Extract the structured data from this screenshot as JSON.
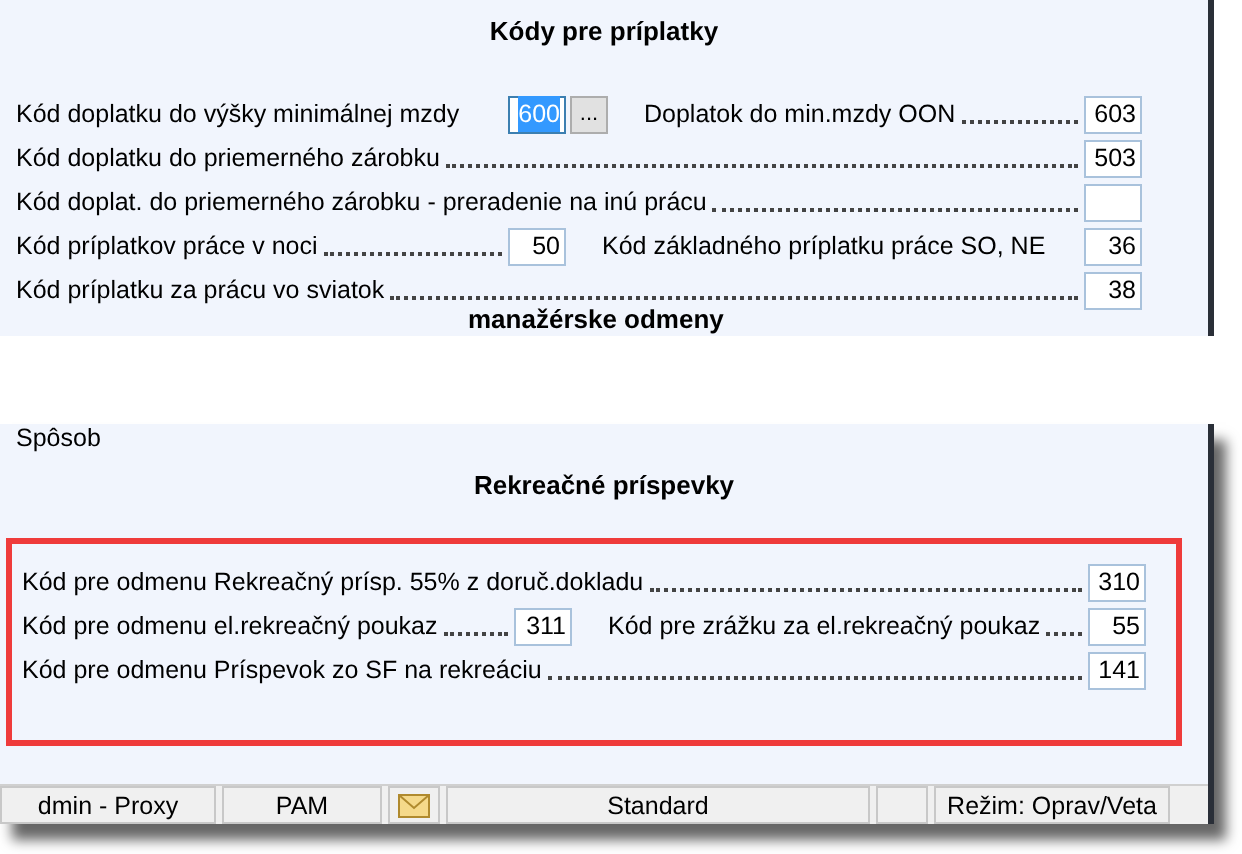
{
  "section_1": {
    "title": "Kódy pre príplatky",
    "rows": [
      {
        "items": [
          {
            "label": "Kód doplatku do výšky minimálnej mzdy",
            "leader": false,
            "value": "600",
            "selected": true,
            "button": "..."
          },
          {
            "label": "Doplatok do min.mzdy OON",
            "leader": true,
            "value": "603",
            "selected": false
          }
        ]
      },
      {
        "items": [
          {
            "label": "Kód doplatku do priemerného zárobku",
            "leader": true,
            "value": "503",
            "selected": false
          }
        ]
      },
      {
        "items": [
          {
            "label": "Kód doplat. do priemerného zárobku - preradenie na inú prácu",
            "leader": true,
            "value": "",
            "selected": false
          }
        ]
      },
      {
        "items": [
          {
            "label": "Kód príplatkov práce v noci",
            "leader": true,
            "value": "50",
            "selected": false
          },
          {
            "label": "Kód základného príplatku práce SO, NE",
            "leader": false,
            "value": "36",
            "selected": false
          }
        ]
      },
      {
        "items": [
          {
            "label": "Kód príplatku za prácu vo sviatok",
            "leader": true,
            "value": "38",
            "selected": false
          }
        ]
      }
    ]
  },
  "torn_section": {
    "title_fragment": "manažérske odmeny",
    "row_fragment": "Spôsob"
  },
  "section_2": {
    "title": "Rekreačné príspevky",
    "highlighted": true,
    "rows": [
      {
        "items": [
          {
            "label": "Kód pre odmenu Rekreačný prísp. 55% z doruč.dokladu",
            "leader": true,
            "value": "310",
            "selected": false
          }
        ]
      },
      {
        "items": [
          {
            "label": "Kód pre odmenu el.rekreačný poukaz",
            "leader": true,
            "value": "311",
            "selected": false
          },
          {
            "label": "Kód pre zrážku za el.rekreačný poukaz",
            "leader": true,
            "value": "55",
            "selected": false
          }
        ]
      },
      {
        "items": [
          {
            "label": "Kód pre odmenu Príspevok zo SF na rekreáciu",
            "leader": true,
            "value": "141",
            "selected": false
          }
        ]
      }
    ]
  },
  "status_bar": [
    {
      "kind": "text",
      "text": "dmin - Proxy"
    },
    {
      "kind": "text",
      "text": "PAM"
    },
    {
      "kind": "mail"
    },
    {
      "kind": "text",
      "text": "Standard"
    },
    {
      "kind": "blank"
    },
    {
      "kind": "text",
      "text": "Režim: Oprav/Veta"
    }
  ]
}
